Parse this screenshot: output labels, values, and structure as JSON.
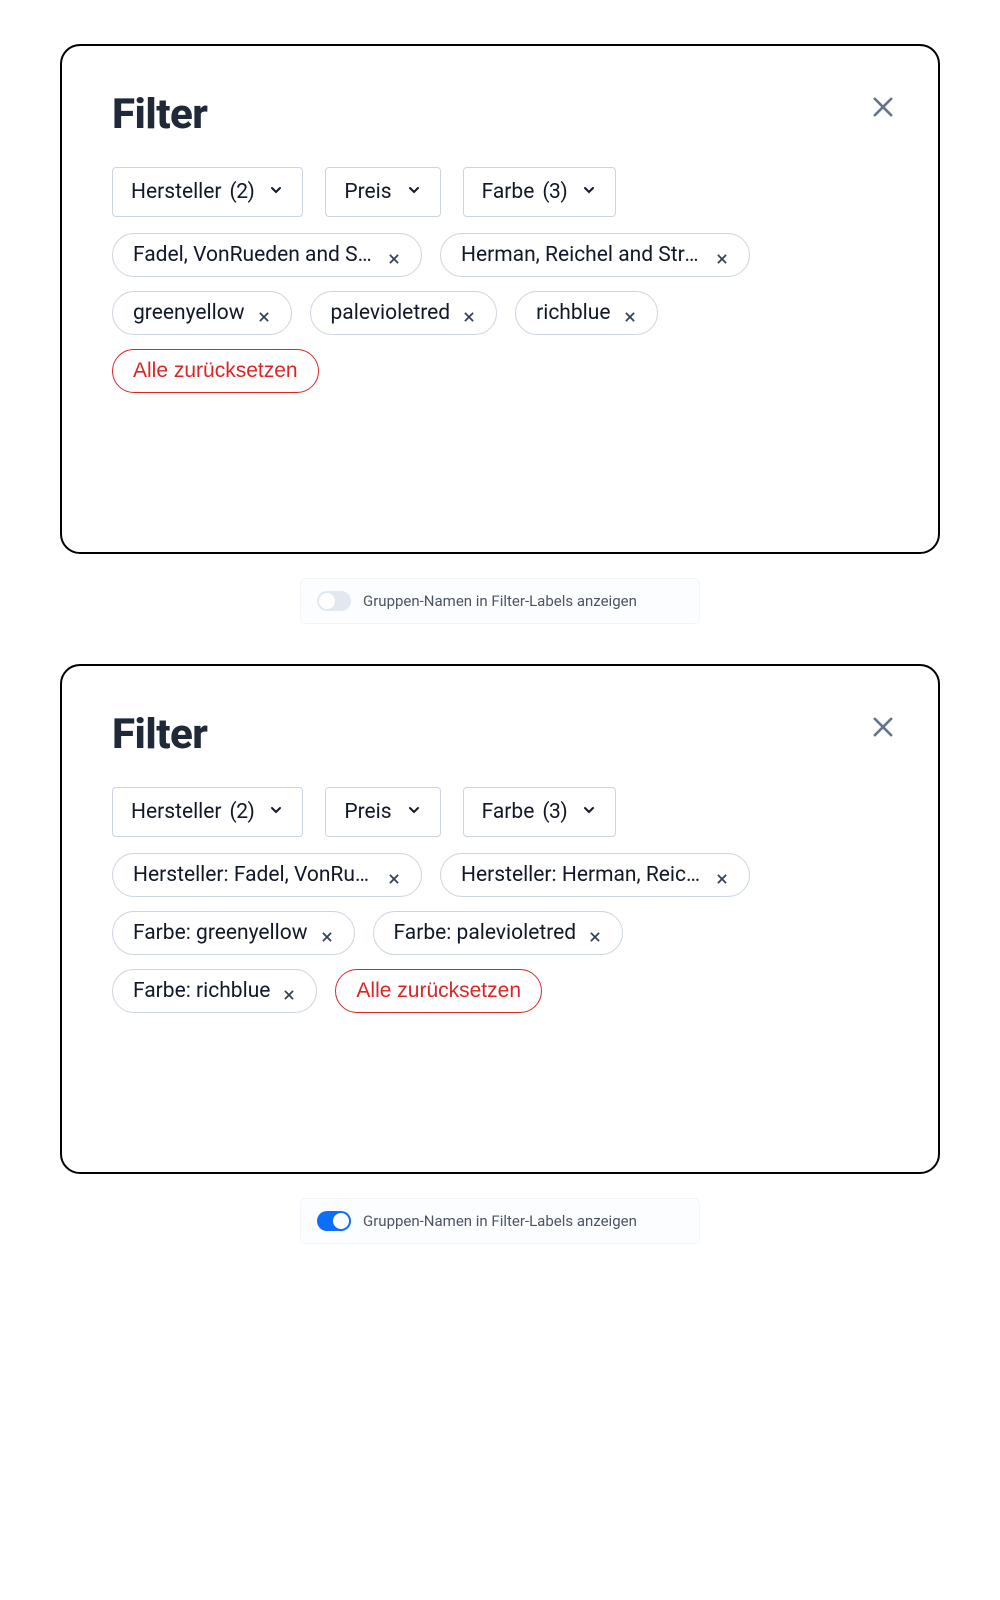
{
  "panel1": {
    "title": "Filter",
    "dropdowns": [
      {
        "label": "Hersteller",
        "count": "(2)"
      },
      {
        "label": "Preis",
        "count": ""
      },
      {
        "label": "Farbe",
        "count": "(3)"
      }
    ],
    "badges": [
      "Fadel, VonRueden and Stanton",
      "Herman, Reichel and Streich",
      "greenyellow",
      "palevioletred",
      "richblue"
    ],
    "reset": "Alle zurücksetzen"
  },
  "panel2": {
    "title": "Filter",
    "dropdowns": [
      {
        "label": "Hersteller",
        "count": "(2)"
      },
      {
        "label": "Preis",
        "count": ""
      },
      {
        "label": "Farbe",
        "count": "(3)"
      }
    ],
    "badges": [
      "Hersteller: Fadel, VonRueden and Stanton",
      "Hersteller: Herman, Reichel and Streich",
      "Farbe: greenyellow",
      "Farbe: palevioletred",
      "Farbe: richblue"
    ],
    "reset": "Alle zurücksetzen"
  },
  "toggle": {
    "label": "Gruppen-Namen in Filter-Labels anzeigen",
    "state_off": false,
    "state_on": true
  }
}
